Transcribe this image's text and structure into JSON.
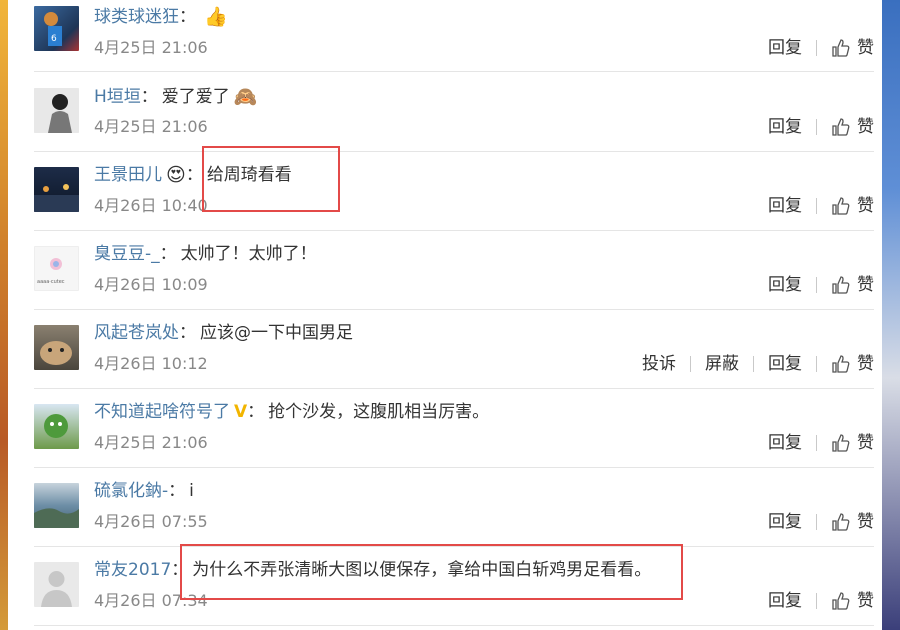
{
  "comments": [
    {
      "username": "球类球迷狂",
      "text": "",
      "emoji": "👍",
      "time": "4月25日 21:06",
      "actions": [
        "回复",
        "赞"
      ]
    },
    {
      "username": "H垣垣",
      "text": "爱了爱了",
      "emoji": "🙈",
      "time": "4月25日 21:06",
      "actions": [
        "回复",
        "赞"
      ]
    },
    {
      "username": "王景田儿",
      "text": "给周琦看看",
      "emoji": "😍",
      "time": "4月26日 10:40",
      "actions": [
        "回复",
        "赞"
      ]
    },
    {
      "username": "臭豆豆-_",
      "text": "太帅了！太帅了！",
      "emoji": "",
      "time": "4月26日 10:09",
      "actions": [
        "回复",
        "赞"
      ]
    },
    {
      "username": "风起苍岚处",
      "text": "应该@一下中国男足",
      "emoji": "",
      "time": "4月26日 10:12",
      "actions": [
        "投诉",
        "屏蔽",
        "回复",
        "赞"
      ]
    },
    {
      "username": "不知道起啥符号了",
      "text": "抢个沙发，这腹肌相当厉害。",
      "emoji": "V",
      "time": "4月25日 21:06",
      "actions": [
        "回复",
        "赞"
      ]
    },
    {
      "username": "硫氯化鈉-",
      "text": "i",
      "emoji": "",
      "time": "4月26日 07:55",
      "actions": [
        "回复",
        "赞"
      ]
    },
    {
      "username": "常友2017",
      "text": "为什么不弄张清晰大图以便保存，拿给中国白斩鸡男足看看。",
      "emoji": "",
      "time": "4月26日 07:34",
      "actions": [
        "回复",
        "赞"
      ]
    }
  ],
  "colon": "：",
  "avatar4_caption": "aaaa·cutec",
  "colors": {
    "username": "#4b7aa5",
    "highlight": "#e34a48"
  }
}
